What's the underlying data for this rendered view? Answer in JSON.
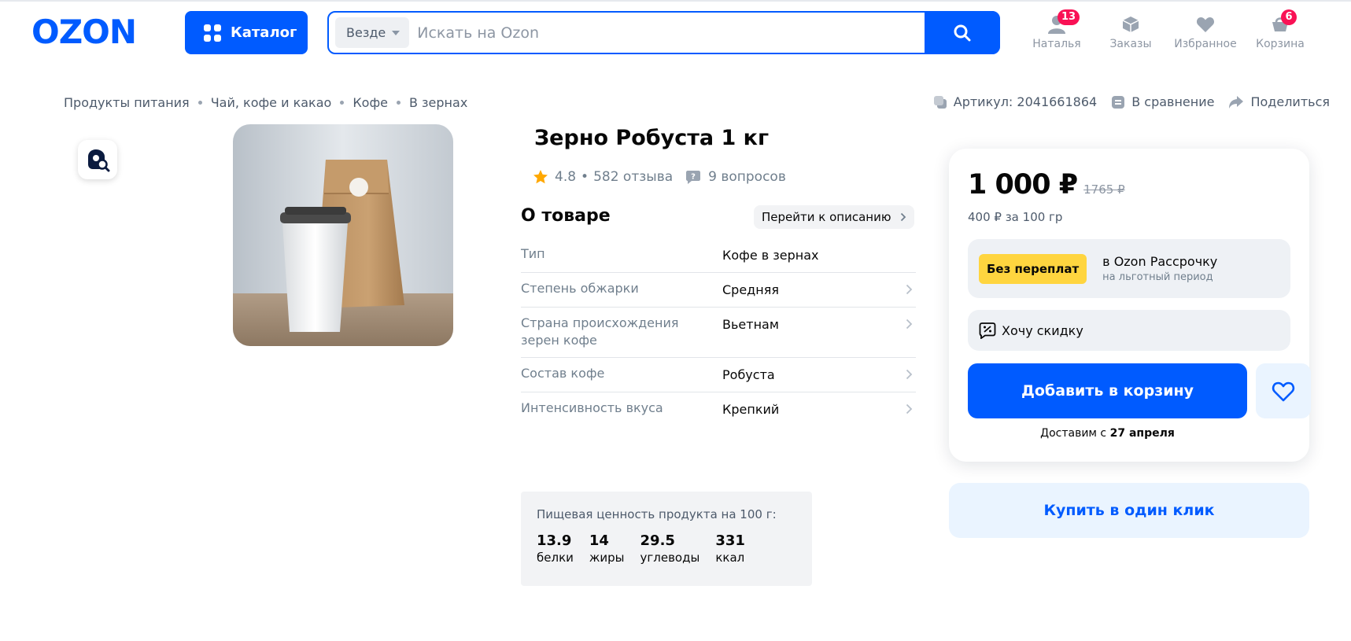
{
  "header": {
    "logo_text": "OZON",
    "catalog_label": "Каталог",
    "search": {
      "scope": "Везде",
      "placeholder": "Искать на Ozon",
      "value": ""
    },
    "nav": [
      {
        "label": "Наталья",
        "icon": "user-icon",
        "badge": "13"
      },
      {
        "label": "Заказы",
        "icon": "box-icon",
        "badge": ""
      },
      {
        "label": "Избранное",
        "icon": "heart-icon",
        "badge": ""
      },
      {
        "label": "Корзина",
        "icon": "cart-icon",
        "badge": "6"
      }
    ]
  },
  "breadcrumbs": [
    "Продукты питания",
    "Чай, кофе и какао",
    "Кофе",
    "В зернах"
  ],
  "meta": {
    "article": "Артикул: 2041661864",
    "compare": "В сравнение",
    "share": "Поделиться"
  },
  "product": {
    "title": "Зерно Робуста 1 кг",
    "rating": "4.8",
    "reviews": "582 отзыва",
    "questions": "9 вопросов"
  },
  "about": {
    "title": "О товаре",
    "goto_label": "Перейти к описанию",
    "attributes": [
      {
        "key": "Тип",
        "value": "Кофе в зернах"
      },
      {
        "key": "Степень обжарки",
        "value": "Средняя"
      },
      {
        "key": "Страна происхождения зерен кофе",
        "value": "Вьетнам"
      },
      {
        "key": "Состав кофе",
        "value": "Робуста"
      },
      {
        "key": "Интенсивность вкуса",
        "value": "Крепкий"
      }
    ]
  },
  "nutrition": {
    "title": "Пищевая ценность продукта на 100 г:",
    "items": [
      {
        "value": "13.9",
        "label": "белки"
      },
      {
        "value": "14",
        "label": "жиры"
      },
      {
        "value": "29.5",
        "label": "углеводы"
      },
      {
        "value": "331",
        "label": "ккал"
      }
    ]
  },
  "buy": {
    "price": "1 000 ₽",
    "old_price": "1765 ₽",
    "unit_price": "400 ₽ за 100 гр",
    "installment_tag": "Без переплат",
    "installment_title": "в Ozon Рассрочку",
    "installment_sub": "на льготный период",
    "discount_label": "Хочу скидку",
    "add_to_cart": "Добавить в корзину",
    "delivery_prefix": "Доставим с",
    "delivery_date": "27 апреля",
    "one_click": "Купить в один клик"
  },
  "colors": {
    "brand": "#005bff",
    "badge": "#f91155",
    "installment_tag": "#ffd53f",
    "star": "#ffa800"
  }
}
